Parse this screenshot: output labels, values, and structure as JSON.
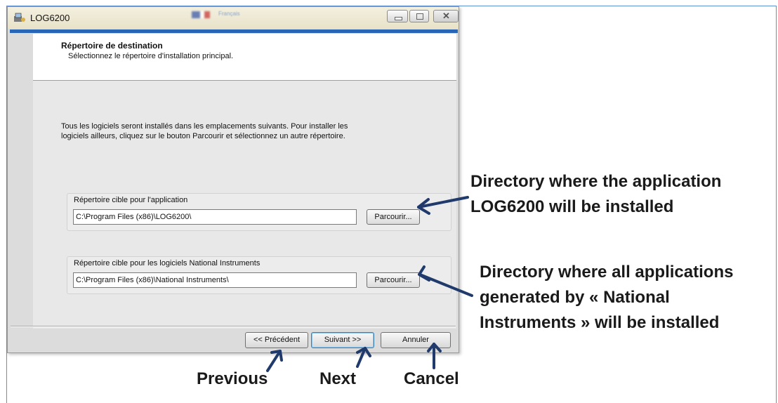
{
  "window": {
    "title": "LOG6200",
    "flag_text": "Français"
  },
  "header": {
    "title": "Répertoire de destination",
    "subtitle": "Sélectionnez le répertoire d'installation principal."
  },
  "main": {
    "intro_line1": "Tous les logiciels seront installés dans les emplacements suivants. Pour installer les",
    "intro_line2": "logiciels ailleurs, cliquez sur le bouton Parcourir et sélectionnez un autre répertoire.",
    "groups": [
      {
        "label": "Répertoire cible pour l'application",
        "path": "C:\\Program Files (x86)\\LOG6200\\",
        "browse_label": "Parcourir..."
      },
      {
        "label": "Répertoire cible pour les logiciels National Instruments",
        "path": "C:\\Program Files (x86)\\National Instruments\\",
        "browse_label": "Parcourir..."
      }
    ]
  },
  "footer": {
    "prev_label": "<< Précédent",
    "next_label": "Suivant >>",
    "cancel_label": "Annuler"
  },
  "annotations": {
    "app_dir_line1": "Directory where the application",
    "app_dir_line2": "LOG6200 will be installed",
    "ni_dir_line1": "Directory where all applications",
    "ni_dir_line2": "generated by « National",
    "ni_dir_line3": "Instruments » will be installed",
    "previous": "Previous",
    "next": "Next",
    "cancel": "Cancel"
  },
  "colors": {
    "accent_bar": "#2a66b8",
    "arrow": "#1f3a6b"
  }
}
